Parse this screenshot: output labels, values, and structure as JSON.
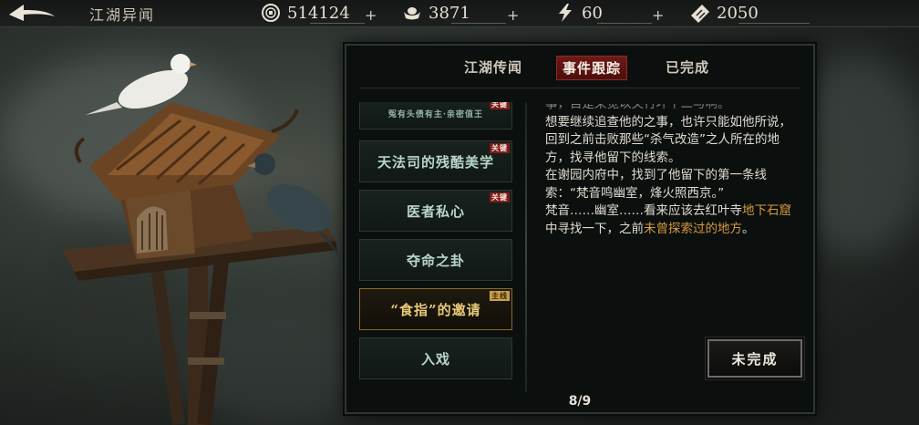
{
  "header": {
    "title": "江湖异闻",
    "resources": [
      {
        "icon": "coin-icon",
        "value": "514124"
      },
      {
        "icon": "silver-ingot-icon",
        "value": "3871"
      },
      {
        "icon": "lightning-icon",
        "value": "60"
      },
      {
        "icon": "ticket-icon",
        "value": "2050"
      }
    ]
  },
  "tabs": [
    {
      "label": "江湖传闻",
      "active": false
    },
    {
      "label": "事件跟踪",
      "active": true
    },
    {
      "label": "已完成",
      "active": false
    }
  ],
  "events": [
    {
      "label": "冤有头债有主·亲密值王",
      "badge": "关键",
      "partial": true
    },
    {
      "label": "天法司的残酷美学",
      "badge": "关键"
    },
    {
      "label": "医者私心",
      "badge": "关键"
    },
    {
      "label": "夺命之卦",
      "badge": ""
    },
    {
      "label": "“食指”的邀请",
      "badge": "主线",
      "selected": true
    },
    {
      "label": "入戏",
      "badge": ""
    }
  ],
  "description": {
    "faded_line": "事，目是采觉以关行坏个二与啊。",
    "p1": "想要继续追查他的之事，也许只能如他所说，回到之前击败那些“杀气改造”之人所在的地方，找寻他留下的线索。",
    "p2": "在谢园内府中，找到了他留下的第一条线索：“梵音鸣幽室，烽火照西京。”",
    "p3_a": "梵音……幽室……看来应该去红叶寺",
    "p3_loc": "地下石窟",
    "p3_b": "中寻找一下，之前",
    "p3_unexplored": "未曾探索过的地方",
    "p3_end": "。"
  },
  "status_button": "未完成",
  "pager": "8/9",
  "colors": {
    "accent_red": "#6e1a17",
    "highlight_orange": "#d99a3c",
    "selected_gold": "#e9c977"
  }
}
